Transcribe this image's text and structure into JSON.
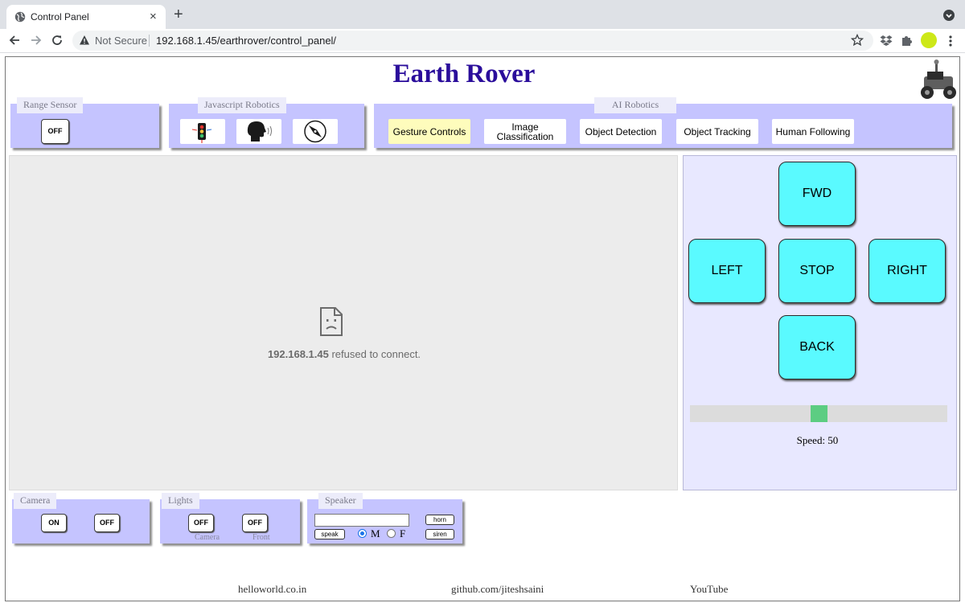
{
  "browser": {
    "tab_title": "Control Panel",
    "tab_close": "×",
    "new_tab": "+",
    "security_label": "Not Secure",
    "url": "192.168.1.45/earthrover/control_panel/"
  },
  "page": {
    "title": "Earth Rover",
    "range_sensor": {
      "label": "Range Sensor",
      "button": "OFF"
    },
    "js_robotics": {
      "label": "Javascript Robotics",
      "buttons": [
        "traffic-light-icon",
        "speaking-head-icon",
        "compass-icon"
      ]
    },
    "ai_robotics": {
      "label": "AI Robotics",
      "buttons": [
        "Gesture Controls",
        "Image Classification",
        "Object Detection",
        "Object Tracking",
        "Human Following"
      ],
      "active": "Gesture Controls"
    },
    "video": {
      "host": "192.168.1.45",
      "message": "refused to connect."
    },
    "drive": {
      "fwd": "FWD",
      "left": "LEFT",
      "stop": "STOP",
      "right": "RIGHT",
      "back": "BACK",
      "speed_label": "Speed: 50",
      "speed_fraction": 0.5
    },
    "camera": {
      "label": "Camera",
      "on": "ON",
      "off": "OFF"
    },
    "lights": {
      "label": "Lights",
      "camera_btn": "OFF",
      "front_btn": "OFF",
      "camera_caption": "Camera",
      "front_caption": "Front"
    },
    "speaker": {
      "label": "Speaker",
      "input_value": "",
      "speak": "speak",
      "horn": "horn",
      "siren": "siren",
      "radio_m": "M",
      "radio_f": "F",
      "selected": "M"
    },
    "footer": {
      "link1": "helloworld.co.in",
      "link2": "github.com/jiteshsaini",
      "link3": "YouTube"
    }
  },
  "colors": {
    "panel": "#c5c4ff",
    "title": "#2a0d9b",
    "drive_button": "#5afaff",
    "slider_thumb": "#5ccd82",
    "active_ai": "#fefcbc"
  }
}
